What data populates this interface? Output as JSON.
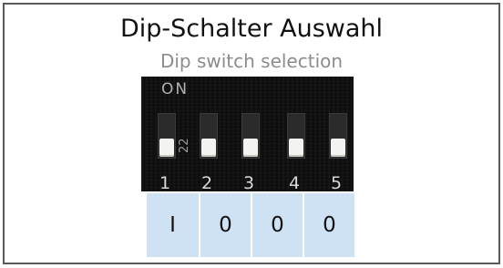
{
  "title": "Dip-Schalter Auswahl",
  "subtitle": "Dip switch selection",
  "dip_switch": {
    "on_label": "ON",
    "side_text": "22",
    "switches": [
      {
        "number": "1",
        "position": "off"
      },
      {
        "number": "2",
        "position": "off"
      },
      {
        "number": "3",
        "position": "off"
      },
      {
        "number": "4",
        "position": "off"
      },
      {
        "number": "5",
        "position": "off"
      }
    ]
  },
  "states": [
    "I",
    "0",
    "0",
    "0"
  ],
  "colors": {
    "border": "#5a5a5a",
    "cell_background": "#cfe2f3",
    "subtitle": "#8c8c8c"
  }
}
